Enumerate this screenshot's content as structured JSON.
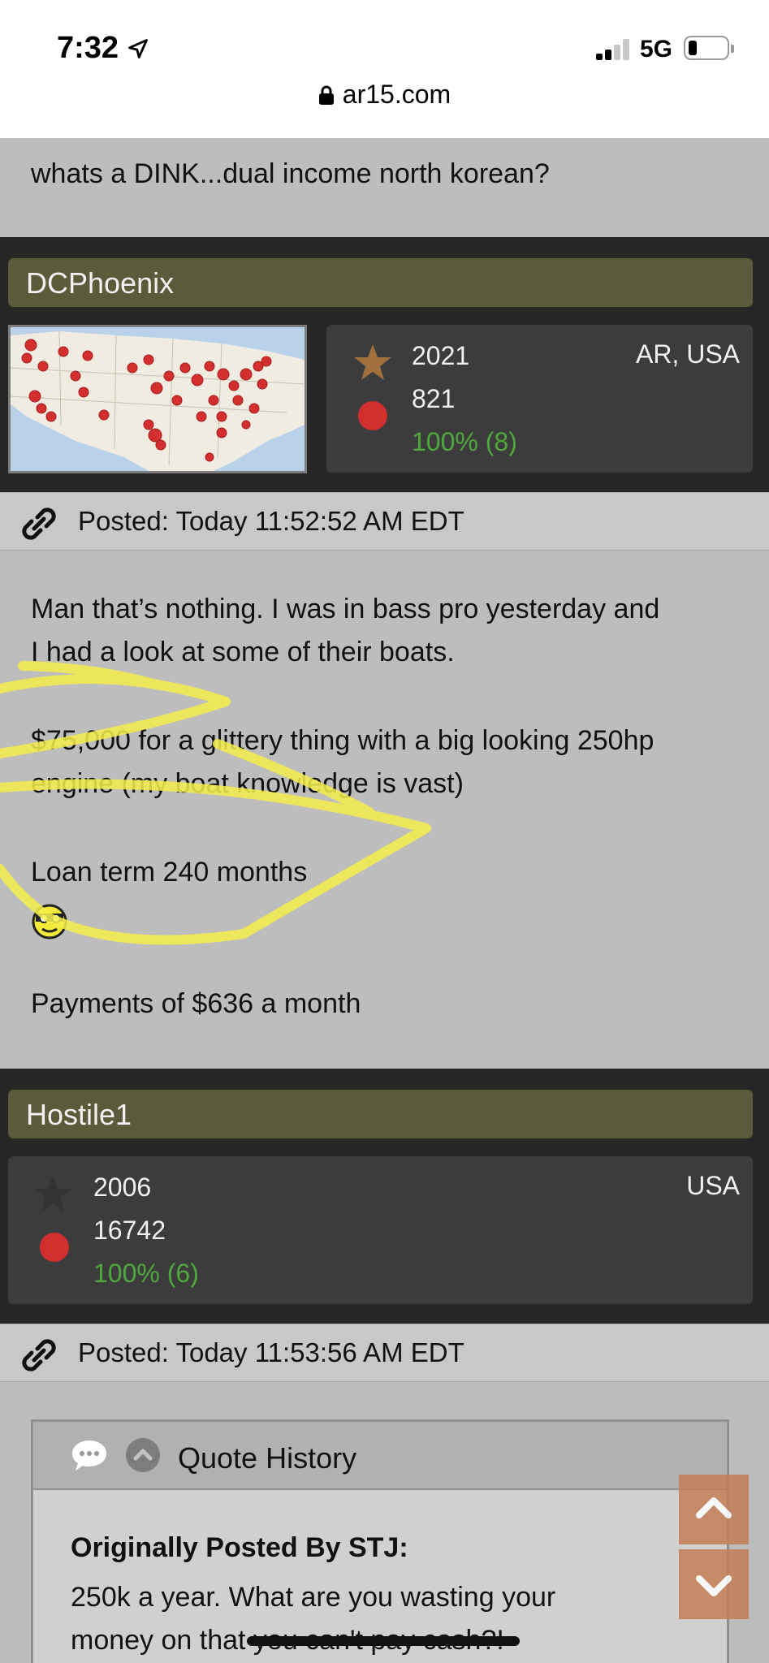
{
  "status_bar": {
    "time": "7:32",
    "network": "5G",
    "url": "ar15.com"
  },
  "posts": {
    "prev_text": "whats a DINK...dual income north korean?",
    "dcphoenix": {
      "username": "DCPhoenix",
      "year": "2021",
      "post_count": "821",
      "feedback": "100% (8)",
      "location": "AR, USA",
      "posted": "Posted: Today 11:52:52 AM EDT",
      "body": [
        "Man that’s nothing. I was in bass pro yesterday and",
        "I had a look at some of their boats.",
        "$75,000 for a glittery thing with a big looking 250hp",
        "engine (my boat knowledge is vast)",
        "Loan term 240 months",
        "Payments of $636 a month"
      ]
    },
    "hostile1": {
      "username": "Hostile1",
      "year": "2006",
      "post_count": "16742",
      "feedback": "100% (6)",
      "location": "USA",
      "posted": "Posted: Today 11:53:56 AM EDT",
      "quote_title": "Quote History",
      "quote_author": "Originally Posted By STJ:",
      "quote_text": "250k a year. What are you wasting your money on that you can't pay cash?!"
    }
  },
  "colors": {
    "namebar": "#5b5a3a",
    "user_block": "#262626",
    "stat_box": "#3c3c3c",
    "feedback_green": "#4fa83d",
    "status_dot": "#d42f2f",
    "star_bronze": "#a0713f",
    "scribble_yellow": "#f4ee4a",
    "scroll_button": "#c47f58"
  },
  "icons": {
    "location": "location-arrow-icon",
    "lock": "lock-icon",
    "link": "link-icon",
    "star": "star-icon",
    "smiley": "smiley-icon",
    "bubble": "speech-bubble-icon",
    "collapse": "chevron-up-circle-icon",
    "scroll_up": "chevron-up-icon",
    "scroll_down": "chevron-down-icon"
  }
}
